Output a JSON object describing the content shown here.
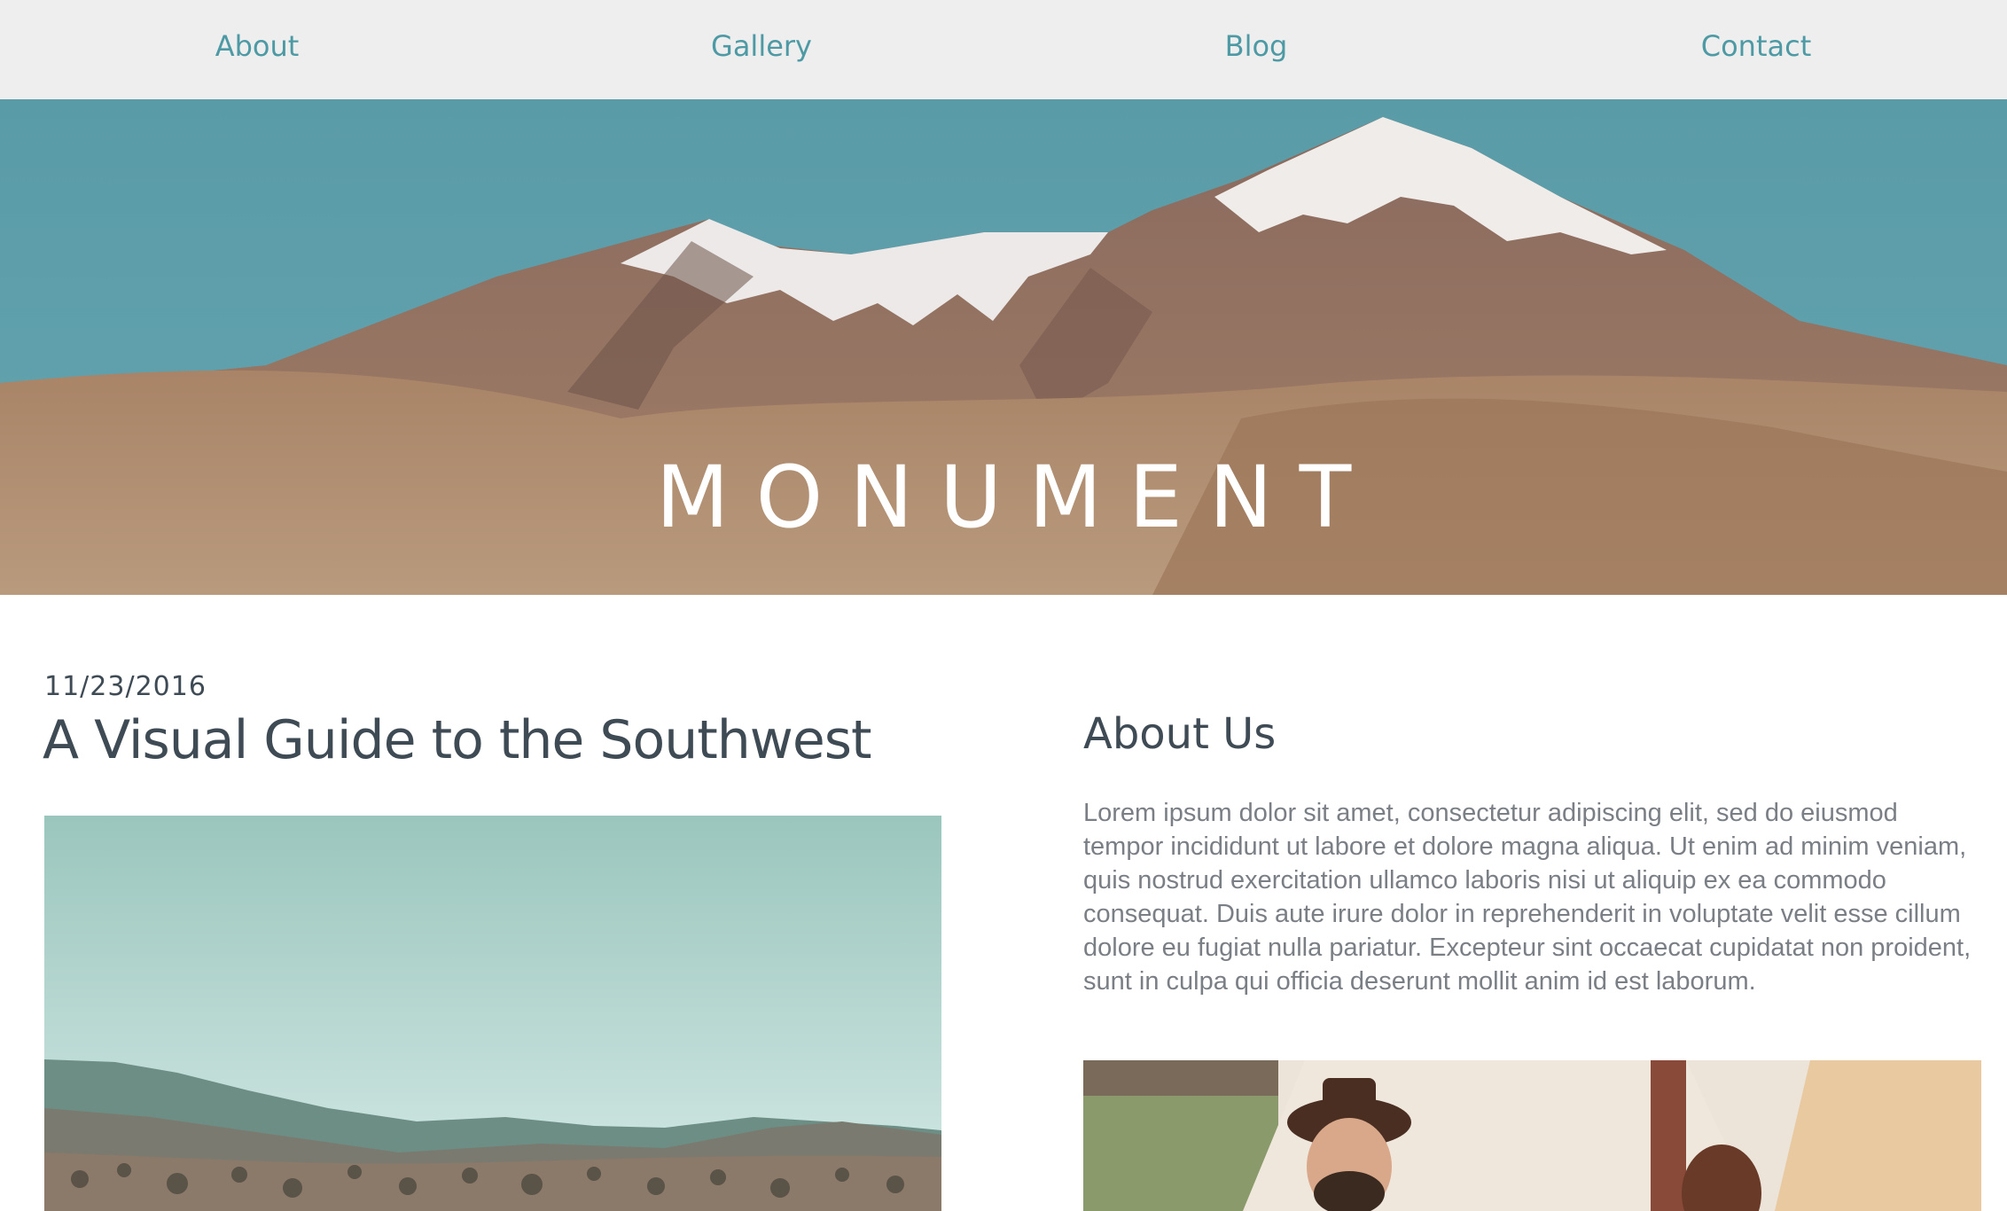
{
  "nav": {
    "items": [
      {
        "label": "About"
      },
      {
        "label": "Gallery"
      },
      {
        "label": "Blog"
      },
      {
        "label": "Contact"
      }
    ]
  },
  "hero": {
    "title": "MONUMENT"
  },
  "post": {
    "date": "11/23/2016",
    "title": "A Visual Guide to the Southwest"
  },
  "about": {
    "heading": "About Us",
    "body": "Lorem ipsum dolor sit amet, consectetur adipiscing elit, sed do eiusmod tempor incididunt ut labore et dolore magna aliqua. Ut enim ad minim veniam, quis nostrud exercitation ullamco laboris nisi ut aliquip ex ea commodo consequat. Duis aute irure dolor in reprehenderit in voluptate velit esse cillum dolore eu fugiat nulla pariatur. Excepteur sint occaecat cupidatat non proident, sunt in culpa qui officia deserunt mollit anim id est laborum."
  },
  "colors": {
    "nav_link": "#4d9aa5",
    "nav_bg": "#eeeeee",
    "heading": "#3e4a54",
    "body_text": "#7a7f85",
    "sky": "#5e9fac"
  }
}
